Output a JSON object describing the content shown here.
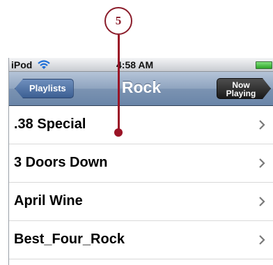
{
  "callout": {
    "number": "5"
  },
  "status_bar": {
    "carrier": "iPod",
    "time": "4:58 AM"
  },
  "nav_bar": {
    "back_label": "Playlists",
    "title": "Rock",
    "now_playing_line1": "Now",
    "now_playing_line2": "Playing"
  },
  "artists": [
    ".38 Special",
    "3 Doors Down",
    "April Wine",
    "Best_Four_Rock"
  ],
  "colors": {
    "callout": "#9a1326",
    "nav_bar": "#7b93b2",
    "back_button": "#3c5f93"
  },
  "icons": {
    "wifi": "wifi-icon",
    "battery": "battery-icon",
    "chevron": "chevron-right-icon"
  }
}
